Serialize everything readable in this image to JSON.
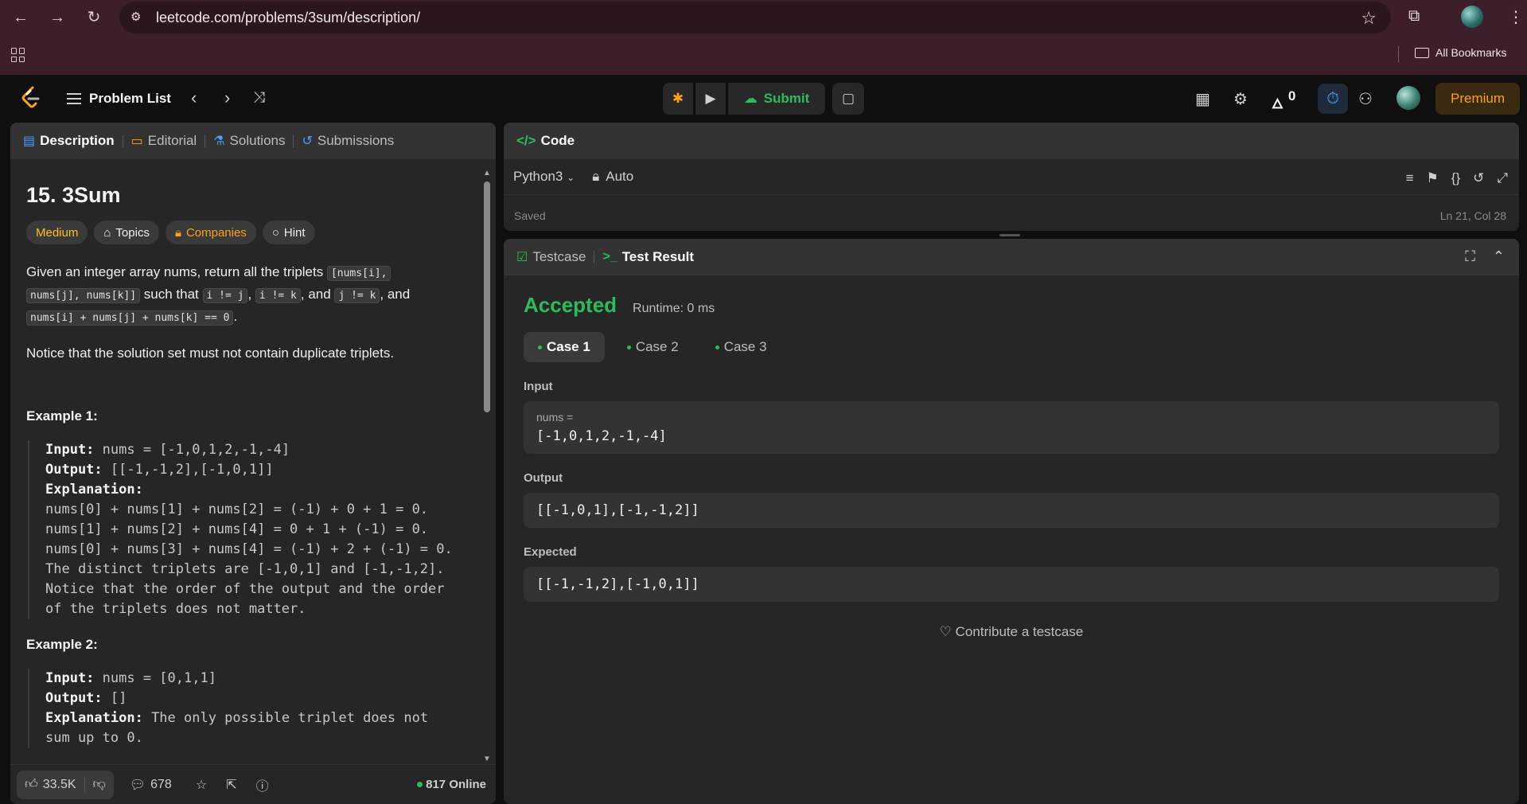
{
  "browser": {
    "url": "leetcode.com/problems/3sum/description/",
    "bookmarks_label": "All Bookmarks"
  },
  "appbar": {
    "problem_list": "Problem List",
    "submit_label": "Submit",
    "streak_count": "0",
    "premium_label": "Premium"
  },
  "desc_tabs": [
    "Description",
    "Editorial",
    "Solutions",
    "Submissions"
  ],
  "problem": {
    "title": "15. 3Sum",
    "difficulty": "Medium",
    "topics": "Topics",
    "companies": "Companies",
    "hint": "Hint",
    "p1_a": "Given an integer array nums, return all the triplets ",
    "p1_code1": "[nums[i],",
    "p1_code2": "nums[j], nums[k]]",
    "p1_b": " such that ",
    "p1_code3": "i != j",
    "p1_c": ", ",
    "p1_code4": "i != k",
    "p1_d": ", and ",
    "p1_code5": "j != k",
    "p1_e": ", and",
    "p1_code6": "nums[i] + nums[j] + nums[k] == 0",
    "p1_f": ".",
    "p2": "Notice that the solution set must not contain duplicate triplets.",
    "ex1_title": "Example 1:",
    "ex1_input_label": "Input:",
    "ex1_input": " nums = [-1,0,1,2,-1,-4]",
    "ex1_output_label": "Output:",
    "ex1_output": " [[-1,-1,2],[-1,0,1]]",
    "ex1_expl_label": "Explanation:",
    "ex1_lines": [
      "nums[0] + nums[1] + nums[2] = (-1) + 0 + 1 = 0.",
      "nums[1] + nums[2] + nums[4] = 0 + 1 + (-1) = 0.",
      "nums[0] + nums[3] + nums[4] = (-1) + 2 + (-1) = 0.",
      "The distinct triplets are [-1,0,1] and [-1,-1,2].",
      "Notice that the order of the output and the order",
      "of the triplets does not matter."
    ],
    "ex2_title": "Example 2:",
    "ex2_input_label": "Input:",
    "ex2_input": " nums = [0,1,1]",
    "ex2_output_label": "Output:",
    "ex2_output": " []",
    "ex2_expl_label": "Explanation:",
    "ex2_expl": " The only possible triplet does not",
    "ex2_expl2": "sum up to 0."
  },
  "footer": {
    "likes": "33.5K",
    "comments": "678",
    "online": "817 Online"
  },
  "code_panel": {
    "tab": "Code",
    "language": "Python3",
    "mode": "Auto",
    "saved": "Saved",
    "cursor": "Ln 21, Col 28"
  },
  "result": {
    "tab_testcase": "Testcase",
    "tab_result": "Test Result",
    "status": "Accepted",
    "runtime": "Runtime: 0 ms",
    "cases": [
      "Case 1",
      "Case 2",
      "Case 3"
    ],
    "input_label": "Input",
    "input_var": "nums =",
    "input_value": "[-1,0,1,2,-1,-4]",
    "output_label": "Output",
    "output_value": "[[-1,0,1],[-1,-1,2]]",
    "expected_label": "Expected",
    "expected_value": "[[-1,-1,2],[-1,0,1]]",
    "contribute": "Contribute a testcase"
  },
  "colors": {
    "accent_green": "#2cbb5d",
    "premium_orange": "#ffa116",
    "medium_yellow": "#ffc01e",
    "timer_blue": "#4a9eff"
  }
}
